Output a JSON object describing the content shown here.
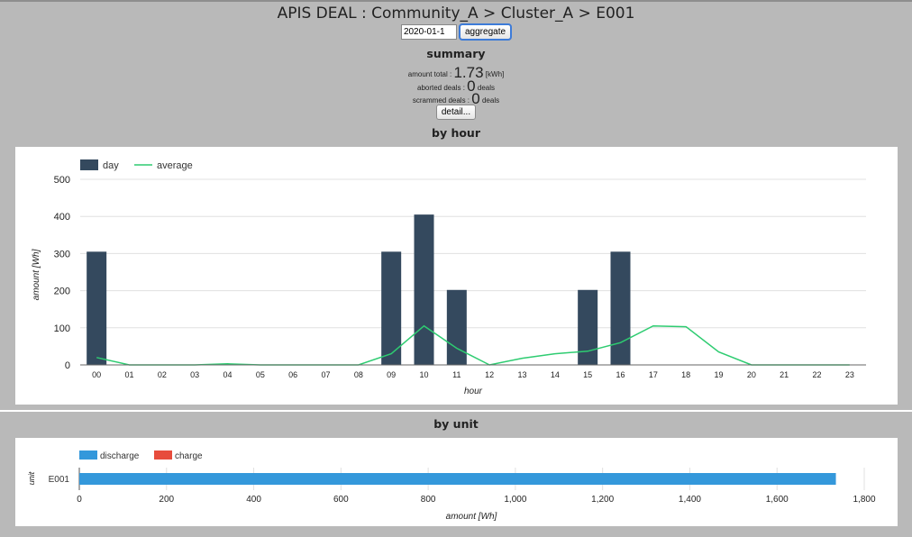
{
  "header": {
    "title": "APIS DEAL : Community_A > Cluster_A > E001",
    "date_value": "2020-01-1",
    "aggregate_label": "aggregate"
  },
  "summary": {
    "heading": "summary",
    "amount_label": "amount total :",
    "amount_value": "1.73",
    "amount_unit": "[kWh]",
    "aborted_label": "aborted deals :",
    "aborted_value": "0",
    "aborted_unit": "deals",
    "scrammed_label": "scrammed deals :",
    "scrammed_value": "0",
    "scrammed_unit": "deals",
    "detail_label": "detail..."
  },
  "colors": {
    "day": "#34495e",
    "average": "#2ecc71",
    "discharge": "#3498db",
    "charge": "#e74c3c"
  },
  "chart_data": [
    {
      "type": "bar",
      "title": "by hour",
      "xlabel": "hour",
      "ylabel": "amount [Wh]",
      "ylim": [
        0,
        500
      ],
      "yticks": [
        0,
        100,
        200,
        300,
        400,
        500
      ],
      "grid": true,
      "legend_position": "top-left",
      "categories": [
        "00",
        "01",
        "02",
        "03",
        "04",
        "05",
        "06",
        "07",
        "08",
        "09",
        "10",
        "11",
        "12",
        "13",
        "14",
        "15",
        "16",
        "17",
        "18",
        "19",
        "20",
        "21",
        "22",
        "23"
      ],
      "series": [
        {
          "name": "day",
          "type": "bar",
          "values": [
            305,
            0,
            0,
            0,
            0,
            0,
            0,
            0,
            0,
            305,
            405,
            202,
            0,
            0,
            0,
            202,
            305,
            0,
            0,
            0,
            0,
            0,
            0,
            0
          ]
        },
        {
          "name": "average",
          "type": "line",
          "values": [
            20,
            0,
            0,
            0,
            3,
            0,
            0,
            0,
            0,
            30,
            105,
            45,
            0,
            18,
            30,
            37,
            60,
            105,
            103,
            35,
            0,
            0,
            0,
            0
          ]
        }
      ]
    },
    {
      "type": "bar",
      "orientation": "horizontal",
      "title": "by unit",
      "xlabel": "amount [Wh]",
      "ylabel": "unit",
      "xlim": [
        0,
        1800
      ],
      "xticks": [
        "0",
        "200",
        "400",
        "600",
        "800",
        "1,000",
        "1,200",
        "1,400",
        "1,600",
        "1,800"
      ],
      "grid": true,
      "legend_position": "top-left",
      "categories": [
        "E001"
      ],
      "series": [
        {
          "name": "discharge",
          "values": [
            1735
          ]
        },
        {
          "name": "charge",
          "values": [
            0
          ]
        }
      ]
    }
  ]
}
